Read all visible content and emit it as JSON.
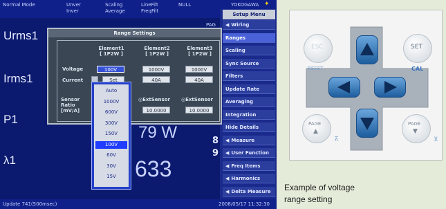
{
  "status": {
    "mode": "Normal Mode",
    "row1": [
      "Unver",
      "Scaling",
      "LineFilt",
      "NULL"
    ],
    "row2": [
      "Inver",
      "Average",
      "FreqFilt"
    ],
    "brand": "YOKOGAWA",
    "page_indicator": "PAG",
    "update": "Update    741(500msec)",
    "datetime": "2008/05/17  11:32:30"
  },
  "measurements": [
    {
      "label": "Urms1",
      "value": ""
    },
    {
      "label": "Irms1",
      "value": ""
    },
    {
      "label": "P1",
      "value": "79 W"
    },
    {
      "label": "λ1",
      "value": "633"
    }
  ],
  "side_digits": [
    "8",
    "9"
  ],
  "setup_menu": {
    "title": "Setup Menu",
    "items": [
      {
        "label": "Wiring",
        "marker": "◀",
        "active": false
      },
      {
        "label": "Ranges",
        "marker": "",
        "active": true
      },
      {
        "label": "Scaling",
        "marker": "",
        "active": false
      },
      {
        "label": "Sync Source",
        "marker": "",
        "active": false
      },
      {
        "label": "Filters",
        "marker": "",
        "active": false
      },
      {
        "label": "Update Rate",
        "marker": "",
        "active": false
      },
      {
        "label": "Averaging",
        "marker": "",
        "active": false
      },
      {
        "label": "Integration",
        "marker": "",
        "active": false
      },
      {
        "label": "Hide Details",
        "marker": "",
        "active": false
      },
      {
        "label": "Measure",
        "marker": "◀",
        "active": false
      },
      {
        "label": "User Function",
        "marker": "◀",
        "active": false
      },
      {
        "label": "Freq Items",
        "marker": "◀",
        "active": false
      },
      {
        "label": "Harmonics",
        "marker": "◀",
        "active": false
      },
      {
        "label": "Delta Measure",
        "marker": "◀",
        "active": false
      }
    ]
  },
  "range_settings": {
    "title": "Range Settings",
    "columns": [
      {
        "name": "Element1",
        "sub": "[ 1P2W ]"
      },
      {
        "name": "Element2",
        "sub": "[ 1P2W ]"
      },
      {
        "name": "Element3",
        "sub": "[ 1P2W ]"
      }
    ],
    "voltage": {
      "label": "Voltage",
      "values": [
        "100V",
        "1000V",
        "1000V"
      ]
    },
    "current": {
      "label": "Current",
      "set_label": "Set",
      "values": [
        "40A",
        "40A"
      ]
    },
    "sensor": {
      "label": "Sensor\nRatio\n[mV/A]",
      "ext_label": "ExtSensor",
      "values": [
        "10.0000",
        "10.0000"
      ]
    }
  },
  "voltage_dropdown": {
    "options": [
      "Auto",
      "1000V",
      "600V",
      "300V",
      "150V",
      "100V",
      "60V",
      "30V",
      "15V"
    ],
    "selected": "100V"
  },
  "keypad": {
    "esc": "ESC",
    "reset": "RESET",
    "set": "SET",
    "cal": "CAL",
    "page_up": "PAGE",
    "page_down": "PAGE"
  },
  "caption": {
    "line1": "Example of voltage",
    "line2": "range setting"
  },
  "colors": {
    "screen_bg": "#0b1a6e",
    "accent": "#3552d6",
    "pad_blue": "#2f6fb0"
  }
}
